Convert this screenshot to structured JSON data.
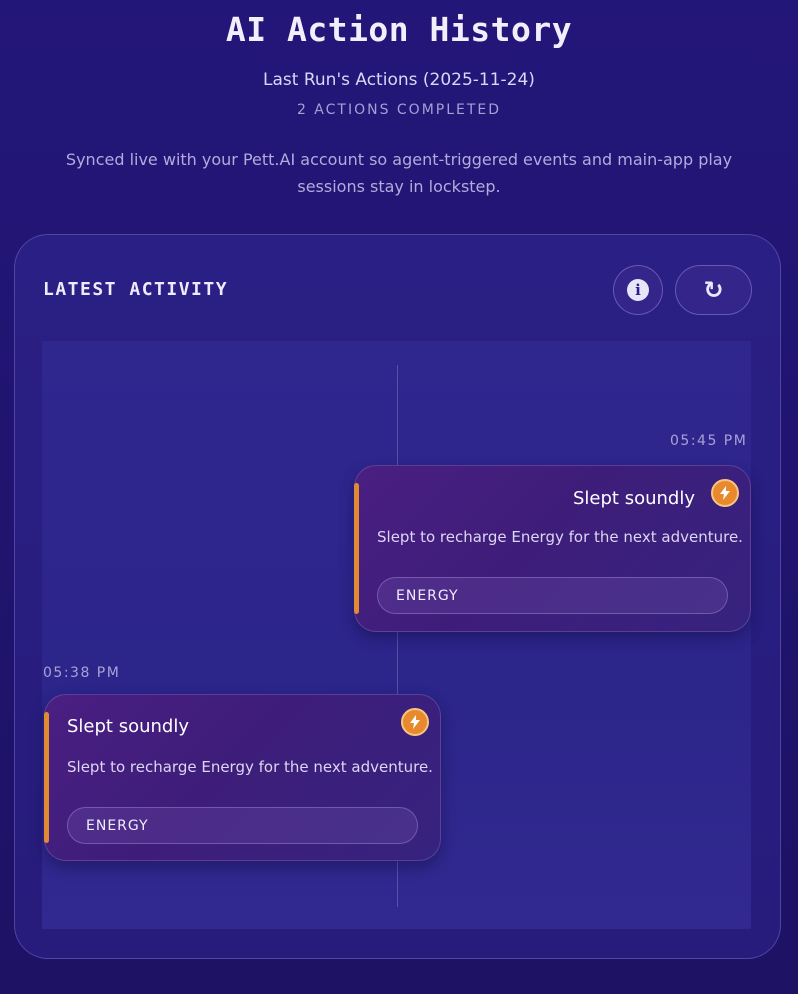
{
  "header": {
    "title": "AI Action History",
    "subtitle": "Last Run's Actions (2025-11-24)",
    "count": "2 ACTIONS COMPLETED",
    "description": "Synced live with your Pett.AI account so agent-triggered events and main-app play sessions stay in lockstep."
  },
  "panel": {
    "title": "LATEST ACTIVITY",
    "info_icon": "info-icon",
    "refresh_icon": "refresh-icon"
  },
  "colors": {
    "background": "#20146f",
    "accent": "#e08a34",
    "card": "#3e1d7a"
  },
  "activities": [
    {
      "time": "05:45 PM",
      "title": "Slept soundly",
      "description": "Slept to recharge Energy for the next adventure.",
      "tag": "ENERGY",
      "icon": "lightning-icon",
      "side": "right"
    },
    {
      "time": "05:38 PM",
      "title": "Slept soundly",
      "description": "Slept to recharge Energy for the next adventure.",
      "tag": "ENERGY",
      "icon": "lightning-icon",
      "side": "left"
    }
  ]
}
